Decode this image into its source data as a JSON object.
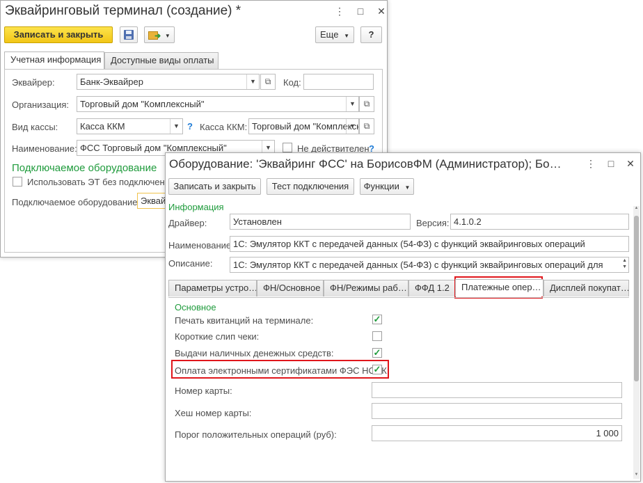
{
  "w1": {
    "title": "Эквайринговый терминал (создание) *",
    "controls": {
      "menu": "⋮",
      "maximize": "□",
      "close": "✕"
    },
    "toolbar": {
      "save_close": "Записать и закрыть",
      "more": "Еще",
      "help": "?"
    },
    "tabs": [
      "Учетная информация",
      "Доступные виды оплаты"
    ],
    "fields": {
      "acquirer": {
        "label": "Эквайрер:",
        "value": "Банк-Эквайрер"
      },
      "code": {
        "label": "Код:",
        "value": ""
      },
      "org": {
        "label": "Организация:",
        "value": "Торговый дом \"Комплексный\""
      },
      "cash_type": {
        "label": "Вид кассы:",
        "value": "Касса ККМ"
      },
      "kkm": {
        "label": "Касса ККМ:",
        "value": "Торговый дом \"Комплексный\""
      },
      "name": {
        "label": "Наименование:",
        "value": "ФСС Торговый дом \"Комплексный\""
      },
      "invalid": {
        "label": "Не действителен",
        "checked": false
      }
    },
    "section": {
      "title": "Подключаемое оборудование",
      "use_et": "Использовать ЭТ без подключения",
      "equipment_label": "Подключаемое оборудование:",
      "equipment_value": "Эквай"
    }
  },
  "w2": {
    "title": "Оборудование: 'Эквайринг ФСС' на БорисовФМ (Администратор); Бо…",
    "controls": {
      "menu": "⋮",
      "maximize": "□",
      "close": "✕"
    },
    "toolbar": {
      "save_close": "Записать и закрыть",
      "test": "Тест подключения",
      "functions": "Функции"
    },
    "info_title": "Информация",
    "driver": {
      "label": "Драйвер:",
      "value": "Установлен"
    },
    "version": {
      "label": "Версия:",
      "value": "4.1.0.2"
    },
    "name": {
      "label": "Наименование:",
      "value": "1С: Эмулятор ККТ с передачей данных (54-ФЗ) с функций эквайринговых операций"
    },
    "description": {
      "label": "Описание:",
      "value": "1С: Эмулятор ККТ с передачей данных (54-ФЗ) с функций эквайринговых операций для"
    },
    "tabs": [
      "Параметры устро…",
      "ФН/Основное",
      "ФН/Режимы раб…",
      "ФФД 1.2",
      "Платежные опер…",
      "Дисплей покупат…"
    ],
    "active_tab": 4,
    "group_title": "Основное",
    "options": [
      {
        "label": "Печать квитанций на терминале:",
        "checked": true
      },
      {
        "label": "Короткие слип чеки:",
        "checked": false
      },
      {
        "label": "Выдачи наличных денежных средств:",
        "checked": true
      },
      {
        "label": "Оплата электронными сертификатами ФЭС НСПК:",
        "checked": true
      }
    ],
    "card_number": {
      "label": "Номер карты:",
      "value": ""
    },
    "card_hash": {
      "label": "Хеш номер карты:",
      "value": ""
    },
    "threshold": {
      "label": "Порог положительных операций (руб):",
      "value": "1 000"
    }
  },
  "colors": {
    "accent_yellow": "#f2c617",
    "section_green": "#1f9b3c",
    "highlight_red": "#e0161b",
    "help_blue": "#1e7bd6"
  }
}
